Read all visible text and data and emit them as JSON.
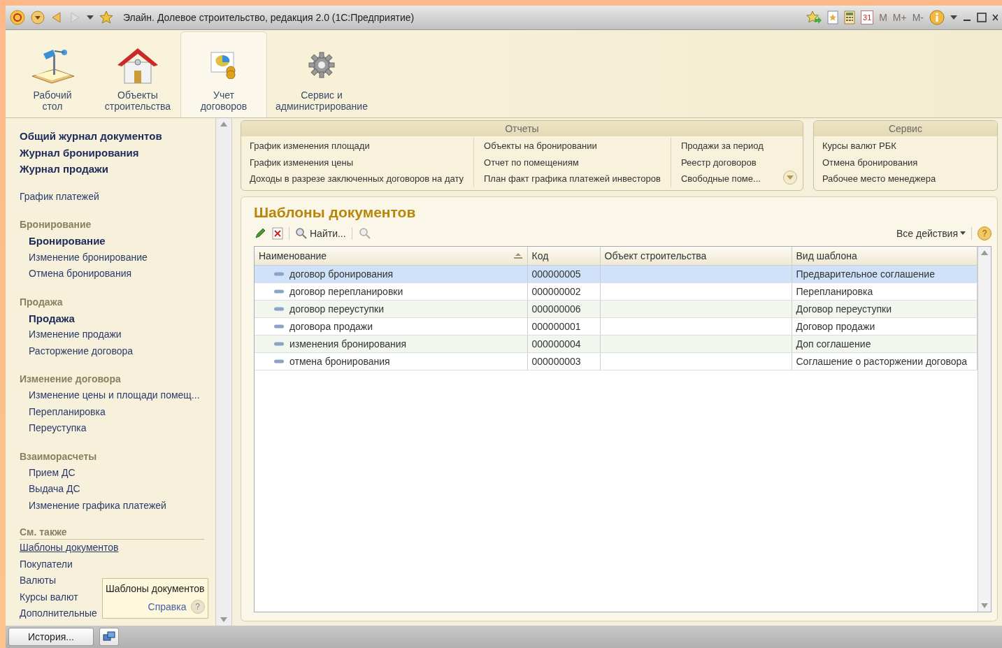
{
  "window": {
    "title": "Элайн. Долевое строительство, редакция 2.0  (1С:Предприятие)",
    "calendar_day": "31",
    "memory_buttons": [
      "M",
      "M+",
      "M-"
    ]
  },
  "sections": [
    {
      "label": "Рабочий\nстол",
      "selected": false
    },
    {
      "label": "Объекты\nстроительства",
      "selected": false
    },
    {
      "label": "Учет\nдоговоров",
      "selected": true
    },
    {
      "label": "Сервис и\nадминистрирование",
      "selected": false
    }
  ],
  "sidebar": {
    "groups": [
      {
        "kind": "plain",
        "items": [
          {
            "label": "Общий журнал документов",
            "kind": "bold"
          },
          {
            "label": "Журнал бронирования",
            "kind": "bold"
          },
          {
            "label": "Журнал продажи",
            "kind": "bold"
          }
        ]
      },
      {
        "kind": "plain",
        "items": [
          {
            "label": "График  платежей",
            "kind": "normal"
          }
        ]
      },
      {
        "kind": "section",
        "header": "Бронирование",
        "items": [
          {
            "label": "Бронирование",
            "kind": "bold"
          },
          {
            "label": "Изменение бронирование",
            "kind": "normal"
          },
          {
            "label": "Отмена бронирования",
            "kind": "normal"
          }
        ]
      },
      {
        "kind": "section",
        "header": "Продажа",
        "items": [
          {
            "label": "Продажа",
            "kind": "bold"
          },
          {
            "label": "Изменение продажи",
            "kind": "normal"
          },
          {
            "label": "Расторжение договора",
            "kind": "normal"
          }
        ]
      },
      {
        "kind": "section",
        "header": "Изменение договора",
        "items": [
          {
            "label": "Изменение цены и площади помещ...",
            "kind": "normal"
          },
          {
            "label": "Перепланировка",
            "kind": "normal"
          },
          {
            "label": "Переуступка",
            "kind": "normal"
          }
        ]
      },
      {
        "kind": "section",
        "header": "Взаиморасчеты",
        "items": [
          {
            "label": "Прием ДС",
            "kind": "normal"
          },
          {
            "label": "Выдача ДС",
            "kind": "normal"
          },
          {
            "label": "Изменение графика платежей",
            "kind": "normal"
          }
        ]
      },
      {
        "kind": "see_also",
        "header": "См. также",
        "items": [
          {
            "label": "Шаблоны документов",
            "kind": "normal",
            "selected": true
          },
          {
            "label": "Покупатели",
            "kind": "normal",
            "selected": false
          },
          {
            "label": "Валюты",
            "kind": "normal",
            "selected": false
          },
          {
            "label": "Курсы валют",
            "kind": "normal",
            "selected": false
          },
          {
            "label": "Дополнительные",
            "kind": "normal",
            "selected": false
          }
        ]
      }
    ]
  },
  "tooltip": {
    "text": "Шаблоны документов",
    "help": "Справка",
    "help_icon": "?"
  },
  "reports": {
    "title": "Отчеты",
    "columns": [
      [
        "График изменения площади",
        "График изменения цены",
        "Доходы в разрезе заключенных договоров на дату"
      ],
      [
        "Объекты на бронировании",
        "Отчет по помещениям",
        "План факт графика платежей инвесторов"
      ],
      [
        "Продажи за период",
        "Реестр договоров",
        "Свободные поме..."
      ]
    ]
  },
  "service": {
    "title": "Сервис",
    "items": [
      "Курсы валют РБК",
      "Отмена бронирования",
      "Рабочее место менеджера"
    ]
  },
  "form": {
    "title": "Шаблоны документов",
    "find_button": "Найти...",
    "all_actions": "Все действия",
    "help_icon": "?",
    "table": {
      "columns": [
        "Наименование",
        "Код",
        "Объект строительства",
        "Вид шаблона"
      ],
      "rows": [
        {
          "name": "договор бронирования",
          "code": "000000005",
          "object": "",
          "kind": "Предварительное соглашение",
          "selected": true
        },
        {
          "name": "договор перепланировки",
          "code": "000000002",
          "object": "",
          "kind": "Перепланировка",
          "selected": false
        },
        {
          "name": "договор переуступки",
          "code": "000000006",
          "object": "",
          "kind": "Договор переуступки",
          "selected": false
        },
        {
          "name": "договора продажи",
          "code": "000000001",
          "object": "",
          "kind": "Договор продажи",
          "selected": false
        },
        {
          "name": "изменения бронирования",
          "code": "000000004",
          "object": "",
          "kind": "Доп соглашение",
          "selected": false
        },
        {
          "name": "отмена бронирования",
          "code": "000000003",
          "object": "",
          "kind": "Соглашение о расторжении договора",
          "selected": false
        }
      ]
    }
  },
  "status_bar": {
    "history_button": "История..."
  }
}
